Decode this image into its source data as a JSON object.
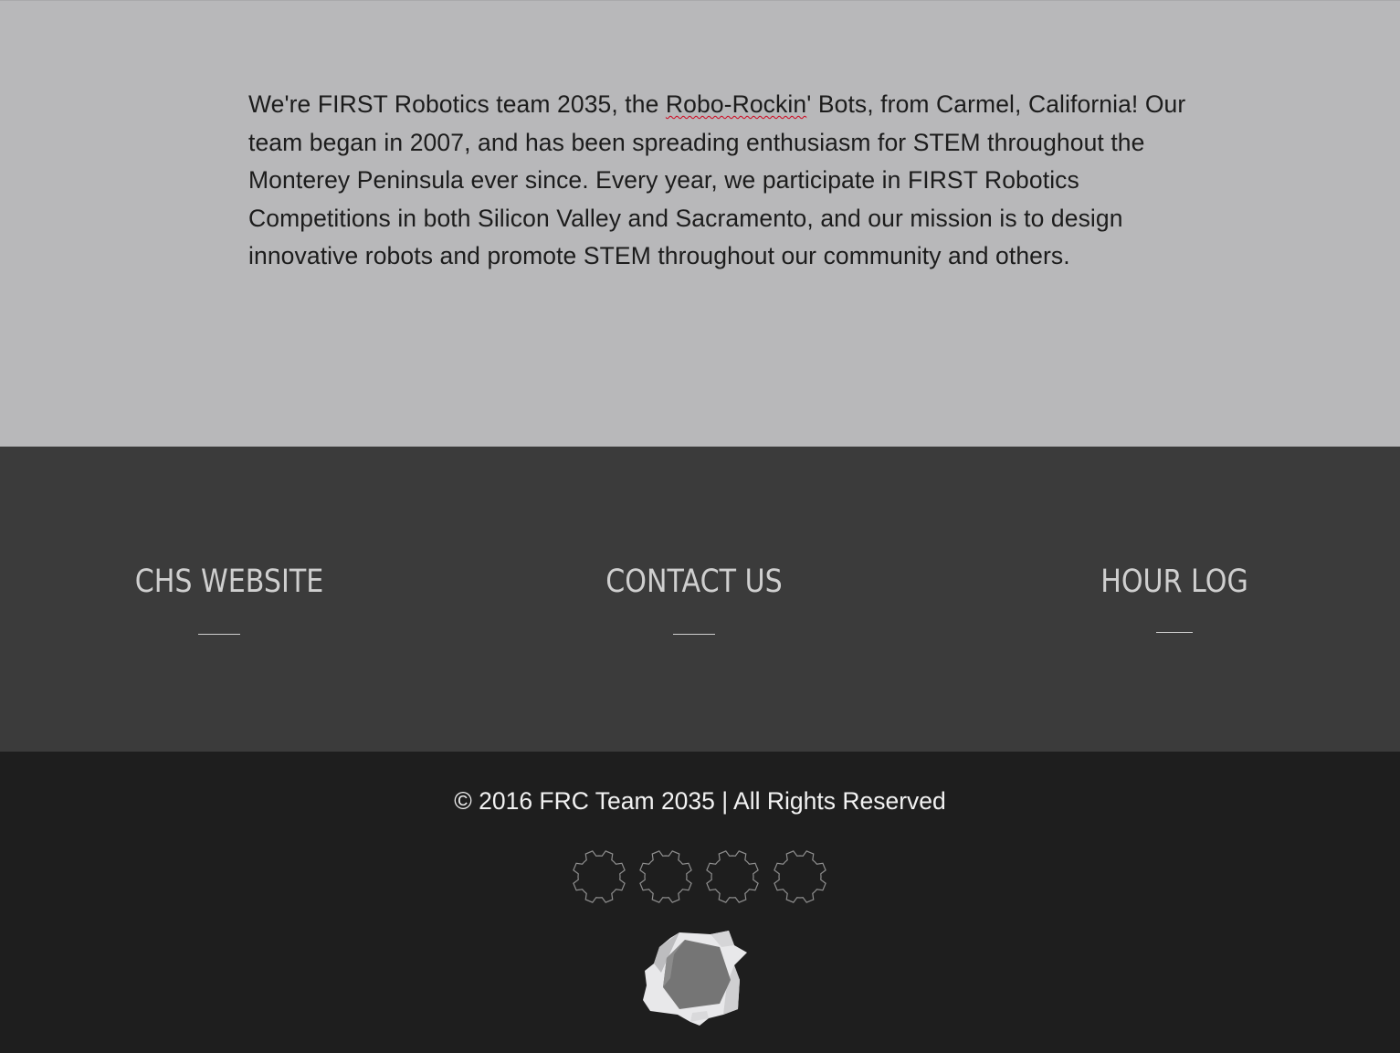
{
  "about": {
    "text_before": "We're FIRST Robotics team 2035, the ",
    "text_misspelled": "Robo-Rockin",
    "text_after": "' Bots, from Carmel, California! Our team began in 2007, and has been spreading enthusiasm for STEM throughout the Monterey Peninsula ever since. Every year, we participate in FIRST Robotics Competitions in both Silicon Valley and Sacramento, and our mission is to design innovative robots and promote STEM throughout our community and others."
  },
  "links": [
    {
      "label": "CHS WEBSITE"
    },
    {
      "label": "CONTACT US"
    },
    {
      "label": "HOUR LOG"
    }
  ],
  "footer": {
    "copyright": "© 2016 FRC Team 2035 | All Rights Reserved",
    "social_icons": [
      "gear-icon",
      "gear-icon",
      "gear-icon",
      "gear-icon"
    ],
    "logo": "team-logo"
  },
  "colors": {
    "about_bg": "#b8b8ba",
    "links_bg": "#3b3b3b",
    "footer_bg": "#1e1e1e",
    "link_text": "#cfcfcf"
  }
}
